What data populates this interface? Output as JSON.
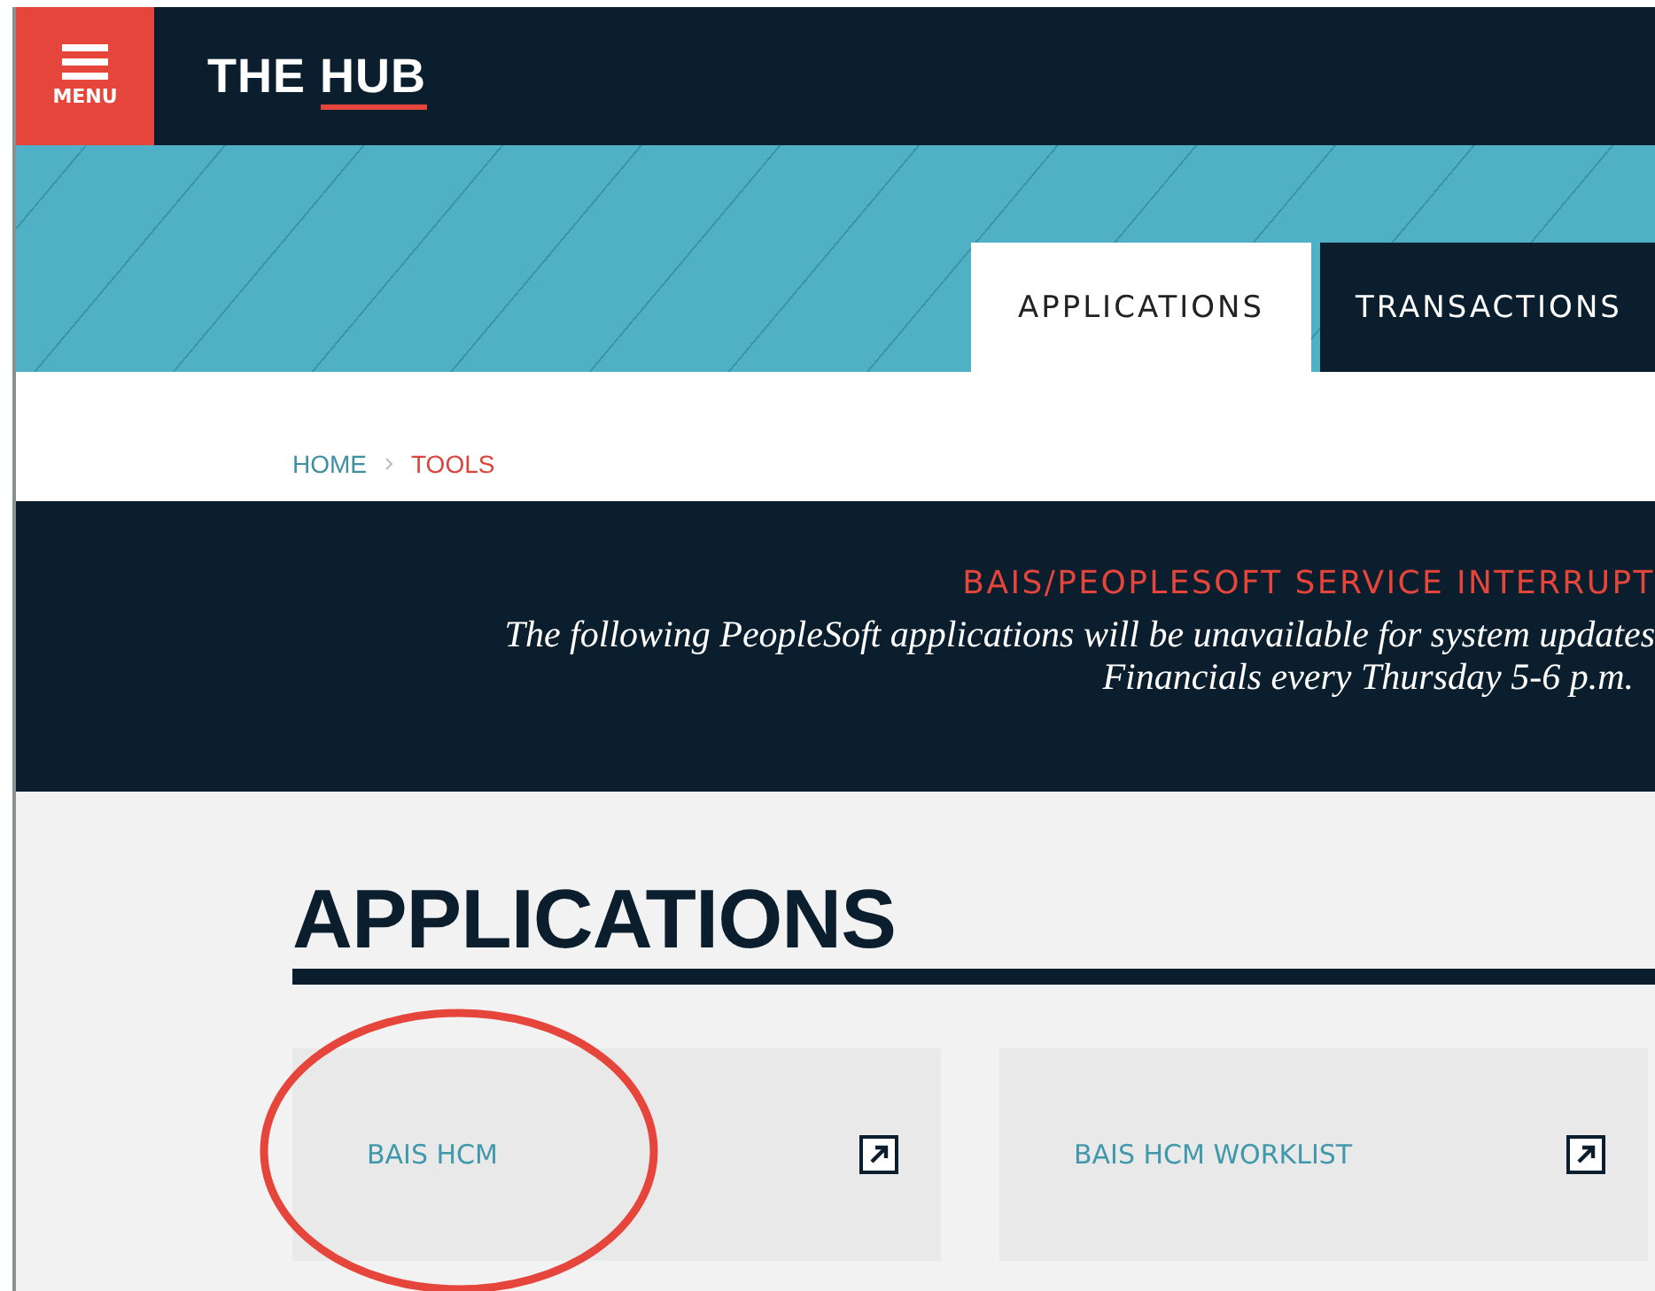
{
  "header": {
    "menu_label": "MENU",
    "title_plain": "THE ",
    "title_underlined": "HUB"
  },
  "tabs": [
    {
      "label": "APPLICATIONS",
      "selected": true
    },
    {
      "label": "TRANSACTIONS",
      "selected": false
    }
  ],
  "breadcrumb": [
    {
      "label": "HOME",
      "current": false
    },
    {
      "label": "TOOLS",
      "current": true
    }
  ],
  "notice": {
    "title": "BAIS/PEOPLESOFT SERVICE INTERRUPT",
    "lines": [
      "The following PeopleSoft applications will be unavailable for system updates",
      "Financials every Thursday 5-6 p.m."
    ]
  },
  "section": {
    "heading": "APPLICATIONS"
  },
  "cards": [
    {
      "label": "BAIS HCM",
      "circled": true
    },
    {
      "label": "BAIS HCM WORKLIST",
      "circled": false
    }
  ]
}
